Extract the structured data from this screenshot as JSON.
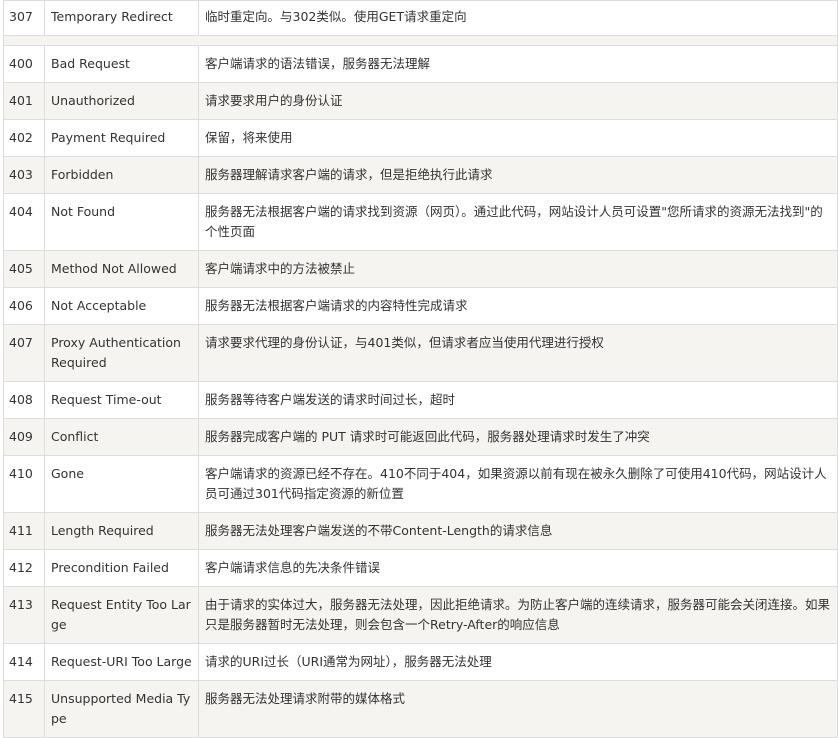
{
  "status_table": {
    "top_rows": [
      {
        "code": "307",
        "name": "Temporary Redirect",
        "desc": "临时重定向。与302类似。使用GET请求重定向"
      }
    ],
    "rows": [
      {
        "code": "400",
        "name": "Bad Request",
        "desc": "客户端请求的语法错误，服务器无法理解"
      },
      {
        "code": "401",
        "name": "Unauthorized",
        "desc": "请求要求用户的身份认证"
      },
      {
        "code": "402",
        "name": "Payment Required",
        "desc": "保留，将来使用"
      },
      {
        "code": "403",
        "name": "Forbidden",
        "desc": "服务器理解请求客户端的请求，但是拒绝执行此请求"
      },
      {
        "code": "404",
        "name": "Not Found",
        "desc": "服务器无法根据客户端的请求找到资源（网页）。通过此代码，网站设计人员可设置\"您所请求的资源无法找到\"的个性页面"
      },
      {
        "code": "405",
        "name": "Method Not Allowed",
        "desc": "客户端请求中的方法被禁止"
      },
      {
        "code": "406",
        "name": "Not Acceptable",
        "desc": "服务器无法根据客户端请求的内容特性完成请求"
      },
      {
        "code": "407",
        "name": "Proxy Authentication Required",
        "desc": "请求要求代理的身份认证，与401类似，但请求者应当使用代理进行授权"
      },
      {
        "code": "408",
        "name": "Request Time-out",
        "desc": "服务器等待客户端发送的请求时间过长，超时"
      },
      {
        "code": "409",
        "name": "Conflict",
        "desc": "服务器完成客户端的 PUT 请求时可能返回此代码，服务器处理请求时发生了冲突"
      },
      {
        "code": "410",
        "name": "Gone",
        "desc": "客户端请求的资源已经不存在。410不同于404，如果资源以前有现在被永久删除了可使用410代码，网站设计人员可通过301代码指定资源的新位置"
      },
      {
        "code": "411",
        "name": "Length Required",
        "desc": "服务器无法处理客户端发送的不带Content-Length的请求信息"
      },
      {
        "code": "412",
        "name": "Precondition Failed",
        "desc": "客户端请求信息的先决条件错误"
      },
      {
        "code": "413",
        "name": "Request Entity Too Large",
        "desc": "由于请求的实体过大，服务器无法处理，因此拒绝请求。为防止客户端的连续请求，服务器可能会关闭连接。如果只是服务器暂时无法处理，则会包含一个Retry-After的响应信息"
      },
      {
        "code": "414",
        "name": "Request-URI Too Large",
        "desc": "请求的URI过长（URI通常为网址），服务器无法处理"
      },
      {
        "code": "415",
        "name": "Unsupported Media Type",
        "desc": "服务器无法处理请求附带的媒体格式"
      }
    ]
  },
  "colors": {
    "row_shade": "#f6f4f0",
    "row_plain": "#ffffff",
    "border": "#dddddd",
    "text": "#333333"
  }
}
